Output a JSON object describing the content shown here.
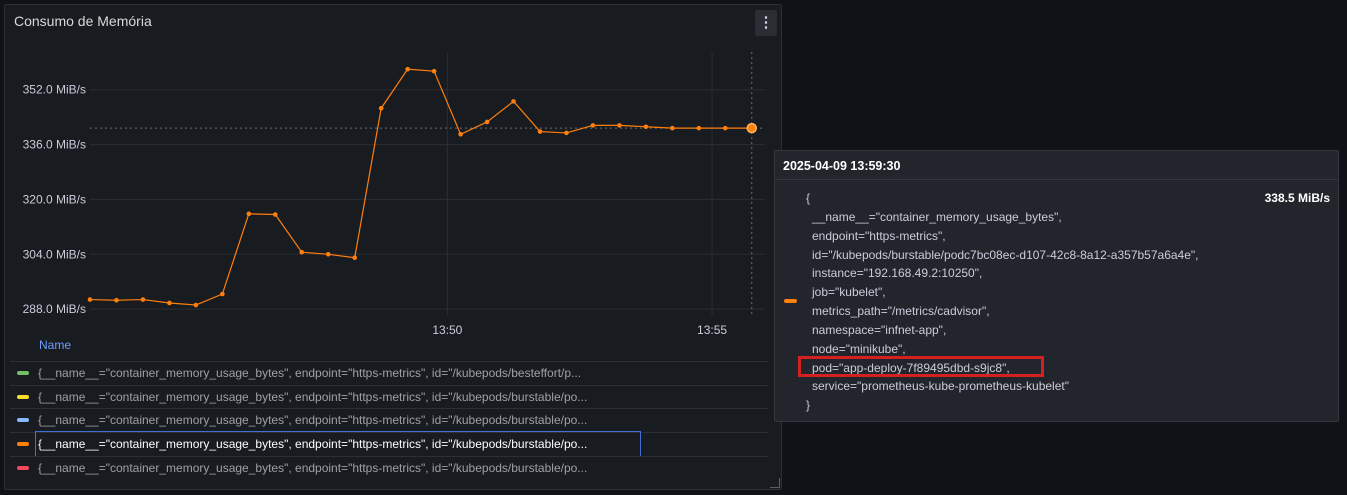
{
  "panel": {
    "title": "Consumo de Memória",
    "menu_icon": "⋮"
  },
  "chart_data": {
    "type": "line",
    "y_ticks": [
      "352.0 MiB/s",
      "336.0 MiB/s",
      "320.0 MiB/s",
      "304.0 MiB/s",
      "288.0 MiB/s"
    ],
    "y_tick_values": [
      352,
      336,
      320,
      304,
      288
    ],
    "ylim": [
      286,
      363
    ],
    "x_ticks": [
      {
        "label": "13:50",
        "value": 13.5
      },
      {
        "label": "13:55",
        "value": 23.5
      }
    ],
    "xlim": [
      0,
      25.5
    ],
    "series": [
      {
        "color": "#ff7f0e",
        "x": [
          0,
          1,
          2,
          3,
          4,
          5,
          6,
          7,
          8,
          9,
          10,
          11,
          12,
          13,
          14,
          15,
          16,
          17,
          18,
          19,
          20,
          21,
          22,
          23,
          24,
          25
        ],
        "values": [
          290.8,
          290.6,
          290.8,
          289.8,
          289.2,
          292.4,
          315.8,
          315.6,
          304.6,
          304.0,
          303.0,
          346.6,
          358.0,
          357.4,
          339.0,
          342.6,
          348.6,
          339.8,
          339.4,
          341.6,
          341.6,
          341.2,
          340.8,
          340.8,
          340.8,
          340.8
        ]
      }
    ],
    "hover_value": 340.8
  },
  "legend": {
    "header": "Name",
    "items": [
      {
        "color": "#73bf69",
        "label": "{__name__=\"container_memory_usage_bytes\", endpoint=\"https-metrics\", id=\"/kubepods/besteffort/p..."
      },
      {
        "color": "#fade2a",
        "label": "{__name__=\"container_memory_usage_bytes\", endpoint=\"https-metrics\", id=\"/kubepods/burstable/po..."
      },
      {
        "color": "#8ab8ff",
        "label": "{__name__=\"container_memory_usage_bytes\", endpoint=\"https-metrics\", id=\"/kubepods/burstable/po..."
      },
      {
        "color": "#ff7f0e",
        "label": "{__name__=\"container_memory_usage_bytes\", endpoint=\"https-metrics\", id=\"/kubepods/burstable/po..."
      },
      {
        "color": "#f2495c",
        "label": "{__name__=\"container_memory_usage_bytes\", endpoint=\"https-metrics\", id=\"/kubepods/burstable/po..."
      }
    ]
  },
  "tooltip": {
    "timestamp": "2025-04-09 13:59:30",
    "value": "338.5 MiB/s",
    "swatch_color": "#ff7f0e",
    "lines": [
      "{",
      "__name__=\"container_memory_usage_bytes\",",
      "endpoint=\"https-metrics\",",
      "id=\"/kubepods/burstable/podc7bc08ec-d107-42c8-8a12-a357b57a6a4e\",",
      "instance=\"192.168.49.2:10250\",",
      "job=\"kubelet\",",
      "metrics_path=\"/metrics/cadvisor\",",
      "namespace=\"infnet-app\",",
      "node=\"minikube\",",
      "pod=\"app-deploy-7f89495dbd-s9jc8\",",
      "service=\"prometheus-kube-prometheus-kubelet\"",
      "}"
    ]
  },
  "colors": {
    "highlight": "#d61f1f",
    "series": "#ff7f0e"
  }
}
